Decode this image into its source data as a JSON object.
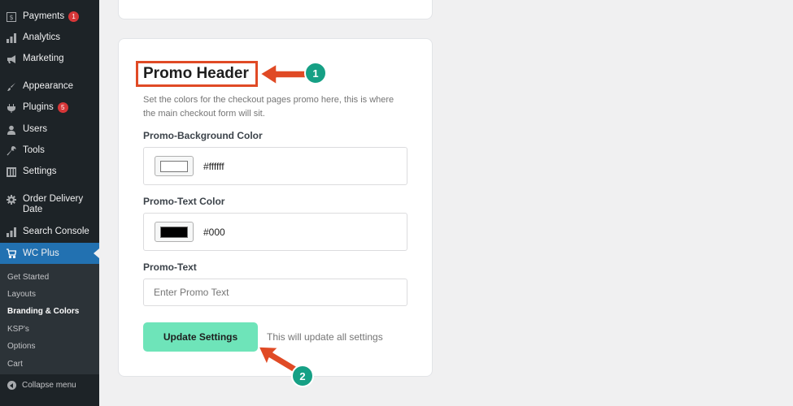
{
  "sidebar": {
    "items": [
      {
        "label": "Payments",
        "icon": "payments-icon",
        "badge": "1"
      },
      {
        "label": "Analytics",
        "icon": "analytics-icon"
      },
      {
        "label": "Marketing",
        "icon": "megaphone-icon"
      },
      {
        "label": "Appearance",
        "icon": "paintbrush-icon"
      },
      {
        "label": "Plugins",
        "icon": "plugins-icon",
        "badge": "5"
      },
      {
        "label": "Users",
        "icon": "users-icon"
      },
      {
        "label": "Tools",
        "icon": "wrench-icon"
      },
      {
        "label": "Settings",
        "icon": "settings-icon"
      },
      {
        "label": "Order Delivery Date",
        "icon": "gear-icon"
      },
      {
        "label": "Search Console",
        "icon": "chart-icon"
      },
      {
        "label": "WC Plus",
        "icon": "cart-icon"
      }
    ],
    "submenu": [
      "Get Started",
      "Layouts",
      "Branding & Colors",
      "KSP's",
      "Options",
      "Cart"
    ],
    "submenu_current": "Branding & Colors",
    "collapse_label": "Collapse menu"
  },
  "promo": {
    "title": "Promo Header",
    "description": "Set the colors for the checkout pages promo here, this is where the main checkout form will sit.",
    "bg_color_label": "Promo-Background Color",
    "bg_color_value": "#ffffff",
    "text_color_label": "Promo-Text Color",
    "text_color_value": "#000",
    "promo_text_label": "Promo-Text",
    "promo_text_placeholder": "Enter Promo Text",
    "update_button": "Update Settings",
    "update_hint": "This will update all settings"
  },
  "annotations": {
    "callout_1": "1",
    "callout_2": "2",
    "color": "#e04a25",
    "badge_color": "#16a085"
  },
  "colors": {
    "sidebar_bg": "#1d2327",
    "active_bg": "#2271b1",
    "button_bg": "#6ee4b9"
  }
}
